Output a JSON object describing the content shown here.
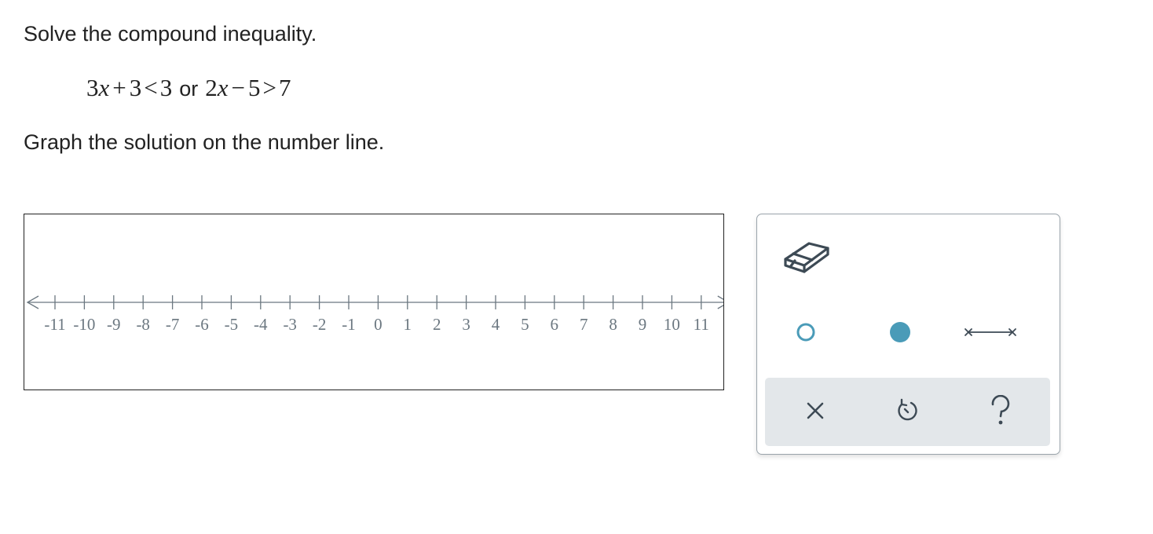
{
  "prompt": {
    "title": "Solve the compound inequality.",
    "equation": {
      "left": {
        "coef1": "3",
        "var1": "x",
        "op1": "+",
        "const1": "3",
        "rel1": "<",
        "rhs1": "3"
      },
      "joiner": "or",
      "right": {
        "coef2": "2",
        "var2": "x",
        "op2": "−",
        "const2": "5",
        "rel2": ">",
        "rhs2": "7"
      }
    },
    "instruction": "Graph the solution on the number line."
  },
  "number_line": {
    "min": -11,
    "max": 11,
    "ticks": [
      "-11",
      "-10",
      "-9",
      "-8",
      "-7",
      "-6",
      "-5",
      "-4",
      "-3",
      "-2",
      "-1",
      "0",
      "1",
      "2",
      "3",
      "4",
      "5",
      "6",
      "7",
      "8",
      "9",
      "10",
      "11"
    ],
    "color": "#6b7780"
  },
  "toolbox": {
    "tools": [
      {
        "name": "eraser-icon",
        "label": "eraser"
      },
      {
        "name": "open-point-icon",
        "label": "open dot"
      },
      {
        "name": "closed-point-icon",
        "label": "closed dot"
      },
      {
        "name": "segment-icon",
        "label": "segment"
      }
    ],
    "actions": [
      {
        "name": "clear-icon",
        "label": "clear"
      },
      {
        "name": "undo-icon",
        "label": "undo"
      },
      {
        "name": "help-icon",
        "label": "help"
      }
    ],
    "accent_color": "#4a9bb8",
    "icon_color": "#3d4a55"
  }
}
